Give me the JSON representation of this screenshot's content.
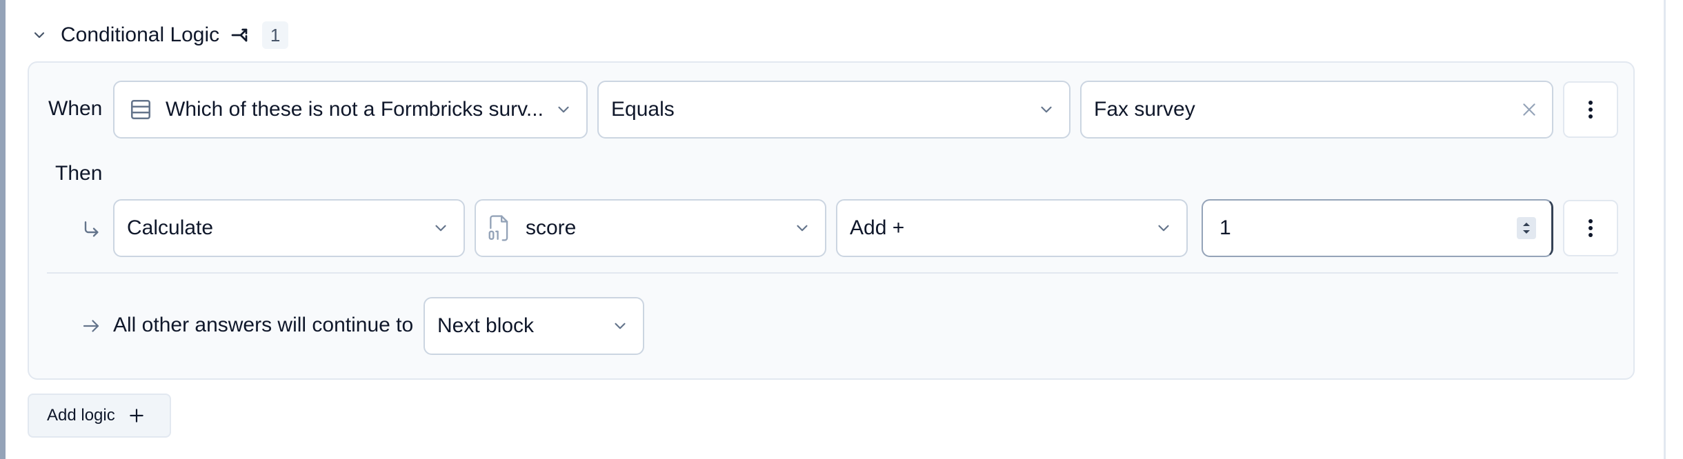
{
  "section": {
    "title": "Conditional Logic",
    "count": "1"
  },
  "logic_rule": {
    "when_label": "When",
    "condition": {
      "question": "Which of these is not a Formbricks surv...",
      "operator": "Equals",
      "value": "Fax survey"
    },
    "then_label": "Then",
    "action": {
      "type": "Calculate",
      "variable": "score",
      "operation": "Add +",
      "amount": "1"
    },
    "fallback": {
      "label": "All other answers will continue to",
      "target": "Next block"
    }
  },
  "add_logic": {
    "label": "Add logic"
  },
  "icons": {
    "collapse": "chevron-down-icon",
    "split": "split-arrows-icon",
    "question_type": "list-rows-icon",
    "variable": "file-digit-icon",
    "clear": "x-icon",
    "menu": "more-vertical-icon",
    "then_arrow": "corner-down-right-icon",
    "fallback_arrow": "arrow-right-icon",
    "stepper": "spin-buttons-icon",
    "add": "plus-icon"
  }
}
